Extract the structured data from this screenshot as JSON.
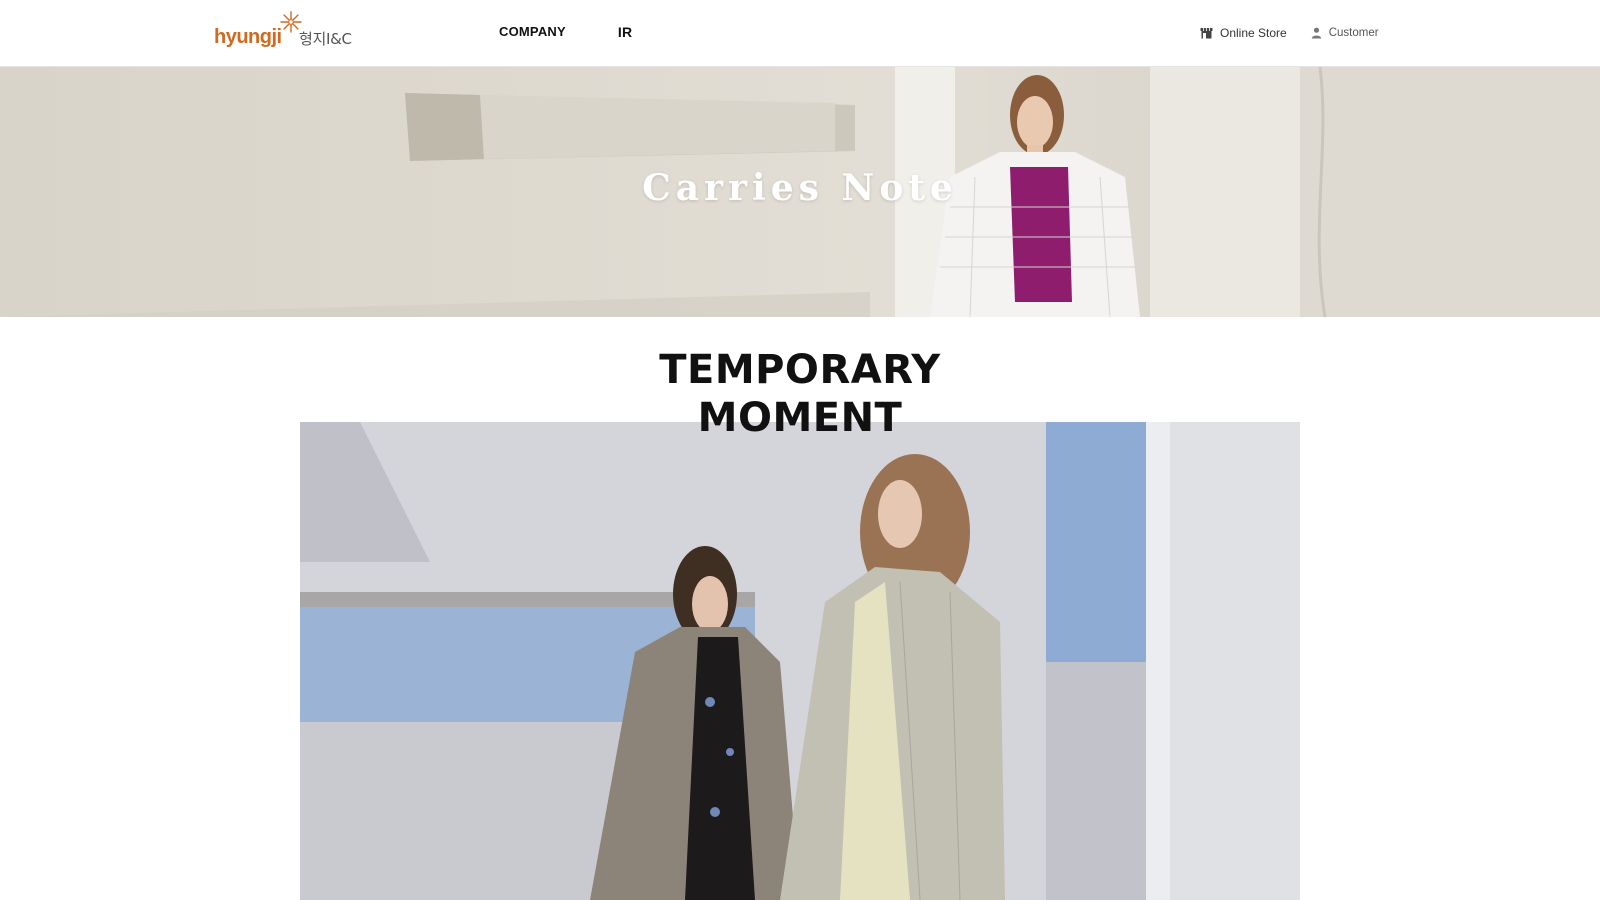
{
  "header": {
    "logo": {
      "en": "hyungji",
      "ko": "형지I&C"
    },
    "nav": [
      {
        "label": "COMPANY"
      },
      {
        "label": "IR"
      }
    ],
    "util": {
      "online_store": {
        "label": "Online Store",
        "icon": "store-icon"
      },
      "customer": {
        "label": "Customer",
        "icon": "user-icon"
      }
    }
  },
  "hero": {
    "title": "Carries Note"
  },
  "section": {
    "title_line1": "TEMPORARY",
    "title_line2": "MOMENT"
  },
  "colors": {
    "brand_orange": "#d2691e",
    "text_dark": "#111111",
    "header_bg": "#ffffff"
  }
}
